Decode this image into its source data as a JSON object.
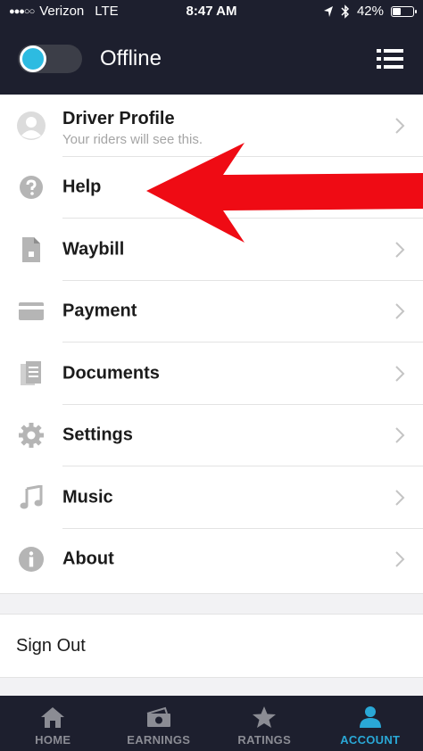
{
  "status_bar": {
    "carrier": "Verizon",
    "network": "LTE",
    "time": "8:47 AM",
    "battery": "42%",
    "battery_level": 0.42
  },
  "header": {
    "status_label": "Offline",
    "toggle_state": "off",
    "accent_color": "#2dbbe1"
  },
  "menu": {
    "items": [
      {
        "label": "Driver Profile",
        "sub": "Your riders will see this.",
        "icon": "avatar-icon"
      },
      {
        "label": "Help",
        "icon": "help-icon"
      },
      {
        "label": "Waybill",
        "icon": "waybill-icon"
      },
      {
        "label": "Payment",
        "icon": "card-icon"
      },
      {
        "label": "Documents",
        "icon": "documents-icon"
      },
      {
        "label": "Settings",
        "icon": "gear-icon"
      },
      {
        "label": "Music",
        "icon": "music-icon"
      },
      {
        "label": "About",
        "icon": "info-icon"
      }
    ]
  },
  "sign_out": {
    "label": "Sign Out"
  },
  "tabs": [
    {
      "label": "HOME",
      "icon": "home-icon",
      "active": false
    },
    {
      "label": "EARNINGS",
      "icon": "earnings-icon",
      "active": false
    },
    {
      "label": "RATINGS",
      "icon": "star-icon",
      "active": false
    },
    {
      "label": "ACCOUNT",
      "icon": "person-icon",
      "active": true
    }
  ],
  "annotation": {
    "type": "red-arrow",
    "points_to": "Help",
    "color": "#ef0b14"
  }
}
